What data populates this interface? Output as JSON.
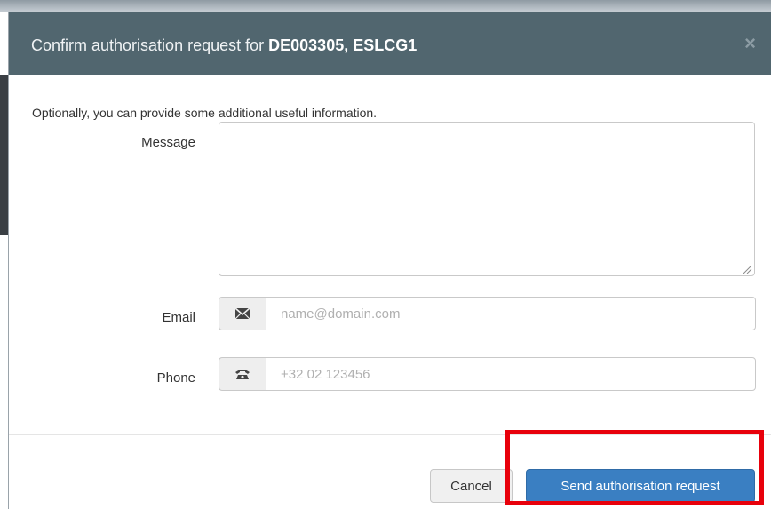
{
  "dialog": {
    "title_prefix": "Confirm authorisation request for ",
    "title_subject": "DE003305, ESLCG1",
    "close_symbol": "×"
  },
  "form": {
    "intro": "Optionally, you can provide some additional useful information.",
    "message_label": "Message",
    "message_value": "",
    "email_label": "Email",
    "email_placeholder": "name@domain.com",
    "email_icon": "envelope-icon",
    "phone_label": "Phone",
    "phone_placeholder": "+32 02 123456",
    "phone_icon": "telephone-icon"
  },
  "footer": {
    "cancel_label": "Cancel",
    "send_label": "Send authorisation request"
  },
  "colors": {
    "header_bg": "#51666f",
    "primary_button": "#3a7fc2",
    "highlight": "#e8000b"
  }
}
